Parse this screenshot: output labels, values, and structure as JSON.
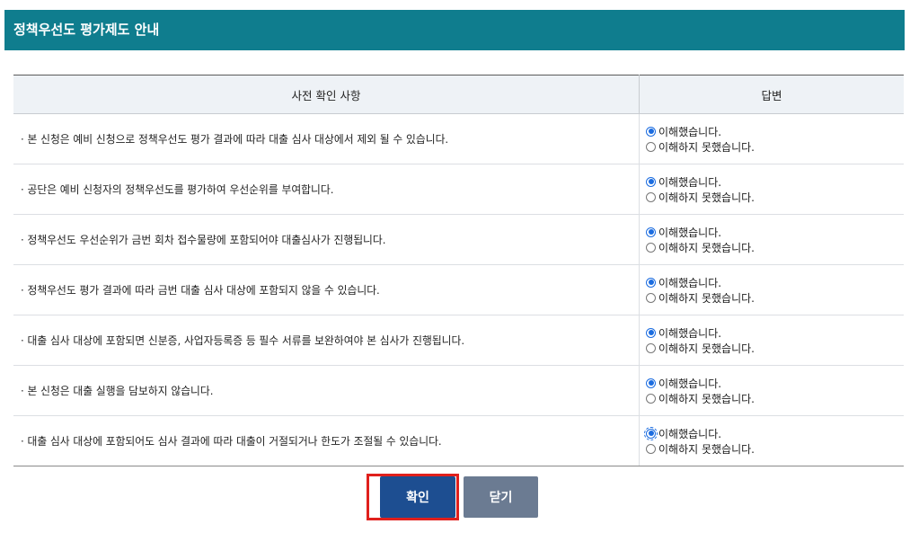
{
  "page": {
    "title": "정책우선도 평가제도 안내"
  },
  "table": {
    "headers": {
      "question": "사전 확인 사항",
      "answer": "답변"
    },
    "rows": [
      {
        "question": "· 본 신청은 예비 신청으로 정책우선도 평가 결과에 따라 대출 심사 대상에서 제외 될 수 있습니다.",
        "selected": "agree"
      },
      {
        "question": "· 공단은 예비 신청자의 정책우선도를 평가하여 우선순위를 부여합니다.",
        "selected": "agree"
      },
      {
        "question": "· 정책우선도 우선순위가 금번 회차 접수물량에 포함되어야 대출심사가 진행됩니다.",
        "selected": "agree"
      },
      {
        "question": "· 정책우선도 평가 결과에 따라 금번 대출 심사 대상에 포함되지 않을 수 있습니다.",
        "selected": "agree"
      },
      {
        "question": "· 대출 심사 대상에 포함되면 신분증, 사업자등록증 등 필수 서류를 보완하여야 본 심사가 진행됩니다.",
        "selected": "agree"
      },
      {
        "question": "· 본 신청은 대출 실행을 담보하지 않습니다.",
        "selected": "agree"
      },
      {
        "question": "· 대출 심사 대상에 포함되어도 심사 결과에 따라 대출이 거절되거나 한도가 조절될 수 있습니다.",
        "selected": "agree"
      }
    ],
    "options": {
      "agree": "이해했습니다.",
      "disagree": "이해하지 못했습니다."
    }
  },
  "buttons": {
    "confirm": "확인",
    "close": "닫기"
  },
  "colors": {
    "title_bar": "#0f7d8e",
    "confirm_button": "#1d4e91",
    "close_button": "#6b7b92",
    "highlight": "#e0201c",
    "radio_selected": "#1b6ce0"
  }
}
